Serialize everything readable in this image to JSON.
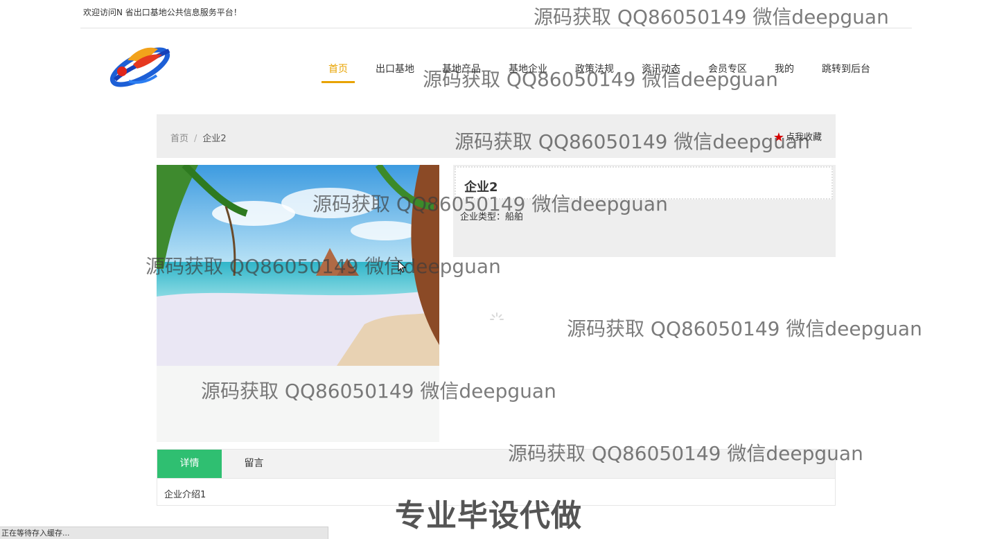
{
  "topbar": {
    "welcome": "欢迎访问N 省出口基地公共信息服务平台！"
  },
  "nav": {
    "items": [
      {
        "label": "首页",
        "active": true
      },
      {
        "label": "出口基地"
      },
      {
        "label": "基地产品"
      },
      {
        "label": "基地企业"
      },
      {
        "label": "政策法规"
      },
      {
        "label": "资讯动态"
      },
      {
        "label": "会员专区"
      },
      {
        "label": "我的"
      },
      {
        "label": "跳转到后台"
      }
    ]
  },
  "breadcrumb": {
    "home": "首页",
    "separator": "/",
    "current": "企业2"
  },
  "favorite": {
    "label": "点我收藏",
    "icon": "star-icon",
    "color": "#d40000"
  },
  "company": {
    "name": "企业2",
    "type_label": "企业类型：",
    "type_value": "船舶"
  },
  "tabs": {
    "items": [
      "详情",
      "留言"
    ],
    "active_color": "#2fbf71"
  },
  "detail": {
    "content": "企业介绍1"
  },
  "status": {
    "text": "正在等待存入缓存..."
  },
  "watermark": {
    "text": "源码获取 QQ86050149 微信deepguan"
  },
  "promo": {
    "text": "专业毕设代做"
  },
  "accent": {
    "nav_active": "#e8a300"
  }
}
